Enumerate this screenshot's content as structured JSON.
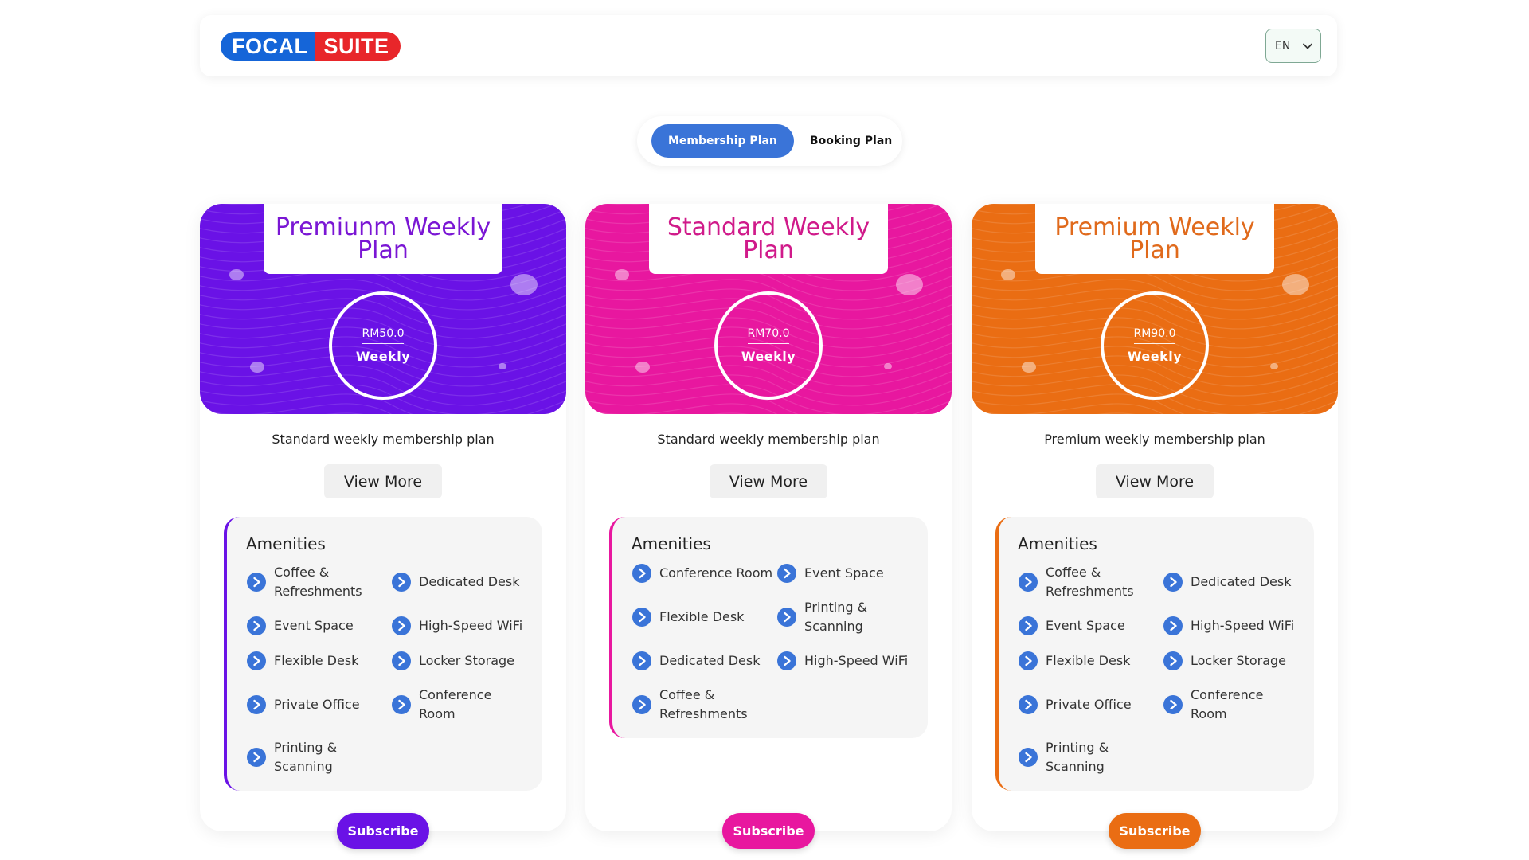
{
  "brand": {
    "logo_left": "FOCAL",
    "logo_right": "SUITE"
  },
  "language": {
    "value": "EN"
  },
  "tabs": [
    {
      "label": "Membership Plan",
      "active": true
    },
    {
      "label": "Booking Plan",
      "active": false
    }
  ],
  "plans": [
    {
      "title": "Premiunm Weekly Plan",
      "price": "RM50.0",
      "period": "Weekly",
      "description": "Standard weekly membership plan",
      "view_more": "View More",
      "amenities_title": "Amenities",
      "amenities": [
        "Coffee & Refreshments",
        "Dedicated Desk",
        "Event Space",
        "High-Speed WiFi",
        "Flexible Desk",
        "Locker Storage",
        "Private Office",
        "Conference Room",
        "Printing & Scanning"
      ],
      "subscribe": "Subscribe",
      "color": "#6a12e6",
      "title_color": "#7a16d4"
    },
    {
      "title": "Standard Weekly Plan",
      "price": "RM70.0",
      "period": "Weekly",
      "description": "Standard weekly membership plan",
      "view_more": "View More",
      "amenities_title": "Amenities",
      "amenities": [
        "Conference Room",
        "Event Space",
        "Flexible Desk",
        "Printing & Scanning",
        "Dedicated Desk",
        "High-Speed WiFi",
        "Coffee & Refreshments"
      ],
      "subscribe": "Subscribe",
      "color": "#e8179f",
      "title_color": "#d01a8a"
    },
    {
      "title": "Premium Weekly Plan",
      "price": "RM90.0",
      "period": "Weekly",
      "description": "Premium weekly membership plan",
      "view_more": "View More",
      "amenities_title": "Amenities",
      "amenities": [
        "Coffee & Refreshments",
        "Dedicated Desk",
        "Event Space",
        "High-Speed WiFi",
        "Flexible Desk",
        "Locker Storage",
        "Private Office",
        "Conference Room",
        "Printing & Scanning"
      ],
      "subscribe": "Subscribe",
      "color": "#ea6d13",
      "title_color": "#e06a1c"
    }
  ],
  "icons": {
    "amenity": "play-circle-icon",
    "dropdown": "chevron-down-icon"
  },
  "colors": {
    "tab_active": "#3a74d8",
    "amenity_icon": "#3a74d8"
  }
}
